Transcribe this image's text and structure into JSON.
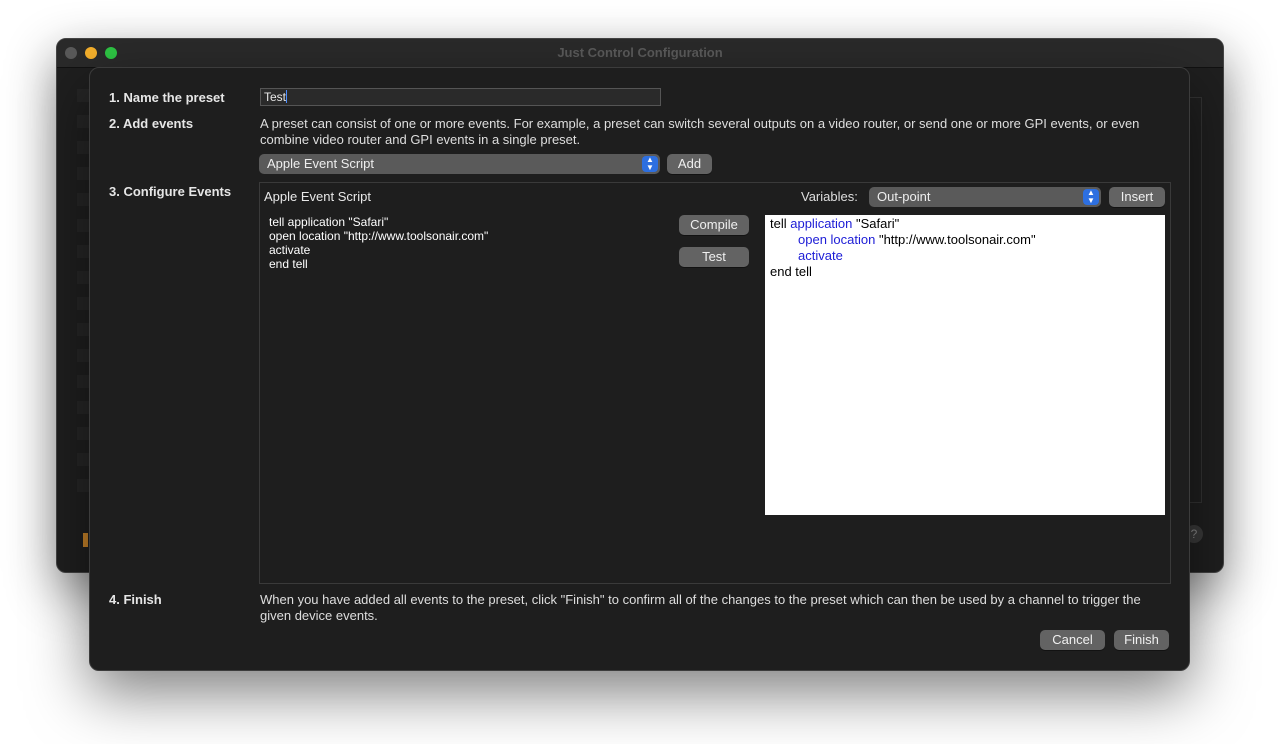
{
  "window": {
    "title": "Just Control Configuration"
  },
  "steps": {
    "name_label": "1. Name the preset",
    "add_label": "2. Add events",
    "configure_label": "3. Configure Events",
    "finish_label": "4. Finish"
  },
  "name_field": {
    "value": "Test"
  },
  "add_events": {
    "description": "A preset can consist of one or more events. For example, a preset can switch several outputs on a video router, or send one or more GPI events, or even combine video router and GPI events in a single preset.",
    "event_type_selected": "Apple Event Script",
    "add_button": "Add"
  },
  "configure": {
    "event_title": "Apple Event Script",
    "variables_label": "Variables:",
    "variables_selected": "Out-point",
    "insert_button": "Insert",
    "compile_button": "Compile",
    "test_button": "Test",
    "source_lines": [
      "tell application \"Safari\"",
      "open location \"http://www.toolsonair.com\"",
      "activate",
      "end tell"
    ],
    "compiled": {
      "line1_a": "tell ",
      "line1_kw": "application",
      "line1_b": " \"Safari\"",
      "line2_kw": "open location",
      "line2_b": " \"http://www.toolsonair.com\"",
      "line3_kw": "activate",
      "line4": "end tell"
    }
  },
  "finish": {
    "description": "When you have added all events to the preset, click \"Finish\" to confirm all of the changes to the preset which can then be used by a channel to trigger the given device events.",
    "cancel_button": "Cancel",
    "finish_button": "Finish"
  },
  "background": {
    "help_glyph": "?"
  }
}
